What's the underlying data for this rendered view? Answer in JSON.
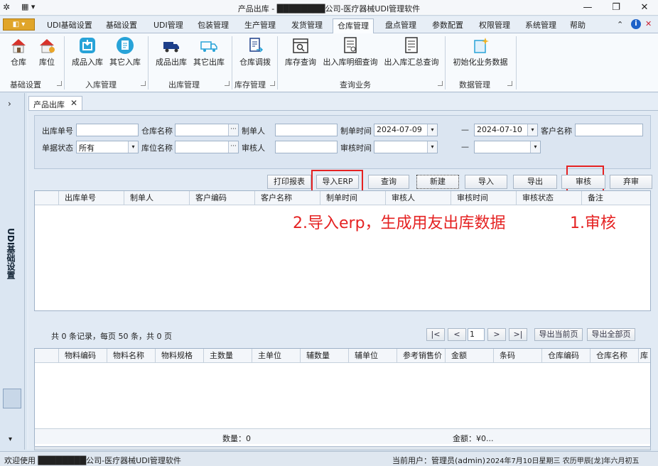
{
  "window": {
    "title": "产品出库 - ████████公司-医疗器械UDI管理软件",
    "min_glyph": "—",
    "max_glyph": "❐",
    "close_glyph": "✕"
  },
  "menu": {
    "app_button": "◧ ▾",
    "tabs": [
      "UDI基础设置",
      "基础设置",
      "UDI管理",
      "包装管理",
      "生产管理",
      "发货管理",
      "仓库管理",
      "盘点管理",
      "参数配置",
      "权限管理",
      "系统管理",
      "帮助"
    ],
    "active_tab": "仓库管理",
    "right_icons": [
      "⌃",
      "i",
      "✕"
    ]
  },
  "ribbon": {
    "buttons": {
      "warehouse": "仓库",
      "location": "库位",
      "product_in": "成品入库",
      "other_in": "其它入库",
      "product_out": "成品出库",
      "other_out": "其它出库",
      "stock_transfer": "仓库调拨",
      "stock_query": "库存查询",
      "io_detail": "出入库明细查询",
      "io_summary": "出入库汇总查询",
      "init_data": "初始化业务数据"
    },
    "groups": {
      "basic": "基础设置",
      "inbound": "入库管理",
      "outbound": "出库管理",
      "inventory": "库存管理",
      "query": "查询业务",
      "data": "数据管理"
    }
  },
  "sidebar": {
    "chevron": "›",
    "vertical_label": "UDI基础设置",
    "bottom_arrow": "▾"
  },
  "doc_tab": {
    "label": "产品出库",
    "close": "✕"
  },
  "filter": {
    "out_no_label": "出库单号",
    "warehouse_name_label": "仓库名称",
    "creator_label": "制单人",
    "create_time_label": "制单时间",
    "create_time_from": "2024-07-09",
    "range_dash": "—",
    "create_time_to": "2024-07-10",
    "customer_name_label": "客户名称",
    "status_label": "单据状态",
    "status_value": "所有",
    "location_name_label": "库位名称",
    "reviewer_label": "审核人",
    "review_time_label": "审核时间",
    "dots": "···",
    "dd": "▾"
  },
  "toolbar": {
    "print": "打印报表",
    "import_erp": "导入ERP",
    "query": "查询",
    "new": "新建",
    "import": "导入",
    "export": "导出",
    "review": "审核",
    "abandon": "弃审"
  },
  "annotations": {
    "import_note": "2.导入erp，生成用友出库数据",
    "review_note": "1.审核"
  },
  "main_grid": {
    "columns": [
      "出库单号",
      "制单人",
      "客户编码",
      "客户名称",
      "制单时间",
      "审核人",
      "审核时间",
      "审核状态",
      "备注"
    ]
  },
  "pager": {
    "summary": "共 0 条记录，每页 50 条，共 0 页",
    "first": "|<",
    "prev": "<",
    "page": "1",
    "next": ">",
    "last": ">|",
    "export_current": "导出当前页",
    "export_all": "导出全部页"
  },
  "detail_grid": {
    "columns": [
      "物料编码",
      "物料名称",
      "物料规格",
      "主数量",
      "主单位",
      "辅数量",
      "辅单位",
      "参考销售价",
      "金额",
      "条码",
      "仓库编码",
      "仓库名称",
      "库"
    ],
    "footer_qty": "数量：0",
    "footer_amount": "金额：¥0..."
  },
  "statusbar": {
    "welcome": "欢迎使用 ████████公司-医疗器械UDI管理软件",
    "current_user": "当前用户：管理员(admin)",
    "date": "2024年7月10日星期三 农历甲辰[龙]年六月初五"
  },
  "colors": {
    "accent": "#e52222",
    "ribbon_bg": "#f7fafd",
    "app_button": "#e0a52a"
  }
}
